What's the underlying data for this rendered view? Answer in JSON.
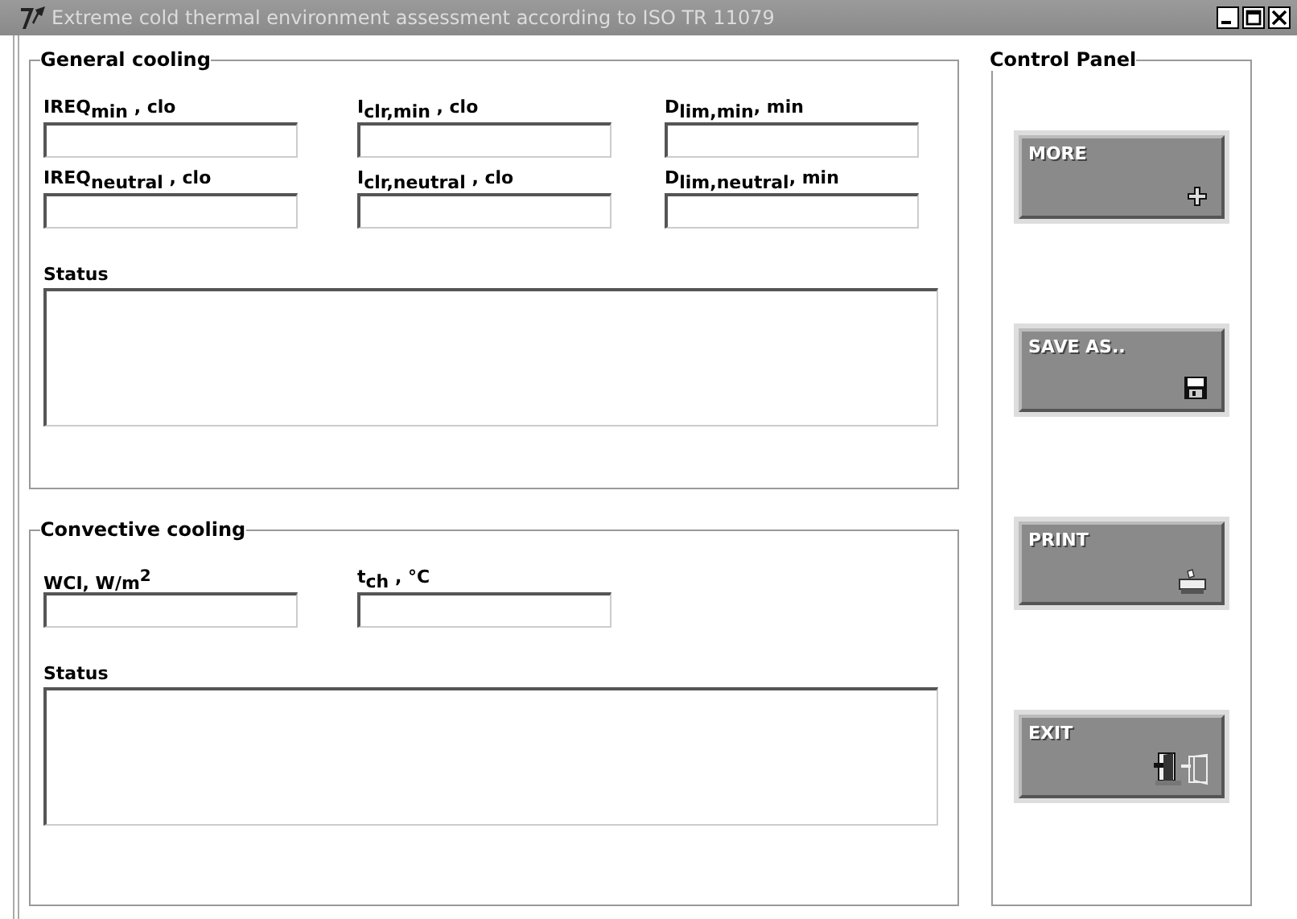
{
  "window": {
    "title": "Extreme cold thermal environment assessment according to ISO TR 11079"
  },
  "general_cooling": {
    "title": "General cooling",
    "fields": [
      {
        "label": "IREQ$_{min}$ , clo"
      },
      {
        "label": "I$_{clr,min}$ , clo"
      },
      {
        "label": "D$_{lim,min}$, min"
      },
      {
        "label": "IREQ$_{neutral}$ , clo"
      },
      {
        "label": "I$_{clr,neutral}$  , clo"
      },
      {
        "label": "D$_{lim,neutral}$, min"
      }
    ],
    "status_label": "Status"
  },
  "convective_cooling": {
    "title": "Convective cooling",
    "fields": [
      {
        "label": "WCI, W/m$^{2}$"
      },
      {
        "label": "t$_{ch}$ , °C"
      }
    ],
    "status_label": "Status"
  },
  "control_panel": {
    "title": "Control Panel",
    "buttons": [
      {
        "label": "MORE",
        "kind": "plus"
      },
      {
        "label": "SAVE AS..",
        "kind": "disk"
      },
      {
        "label": "PRINT",
        "kind": "printer"
      },
      {
        "label": "EXIT",
        "kind": "exit"
      }
    ]
  }
}
